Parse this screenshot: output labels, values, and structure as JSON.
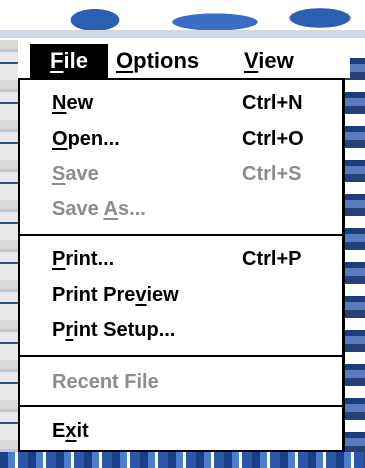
{
  "menubar": {
    "file": {
      "label_pre": "",
      "label_key": "F",
      "label_post": "ile"
    },
    "options": {
      "label_pre": "",
      "label_key": "O",
      "label_post": "ptions"
    },
    "view": {
      "label_pre": "",
      "label_key": "V",
      "label_post": "iew"
    }
  },
  "file_menu": {
    "new": {
      "pre": "",
      "key": "N",
      "post": "ew",
      "shortcut": "Ctrl+N",
      "enabled": true
    },
    "open": {
      "pre": "",
      "key": "O",
      "post": "pen...",
      "shortcut": "Ctrl+O",
      "enabled": true
    },
    "save": {
      "pre": "",
      "key": "S",
      "post": "ave",
      "shortcut": "Ctrl+S",
      "enabled": false
    },
    "save_as": {
      "pre": "Save ",
      "key": "A",
      "post": "s...",
      "shortcut": "",
      "enabled": false
    },
    "print": {
      "pre": "",
      "key": "P",
      "post": "rint...",
      "shortcut": "Ctrl+P",
      "enabled": true
    },
    "print_preview": {
      "pre": "Print Pre",
      "key": "v",
      "post": "iew",
      "shortcut": "",
      "enabled": true
    },
    "print_setup": {
      "pre": "P",
      "key": "r",
      "post": "int Setup...",
      "shortcut": "",
      "enabled": true
    },
    "recent_file": {
      "label": "Recent File",
      "enabled": false
    },
    "exit": {
      "pre": "E",
      "key": "x",
      "post": "it",
      "shortcut": "",
      "enabled": true
    }
  },
  "colors": {
    "menu_text": "#000000",
    "disabled_text": "#8c8c8c",
    "highlight_bg": "#000000",
    "highlight_text": "#ffffff"
  }
}
